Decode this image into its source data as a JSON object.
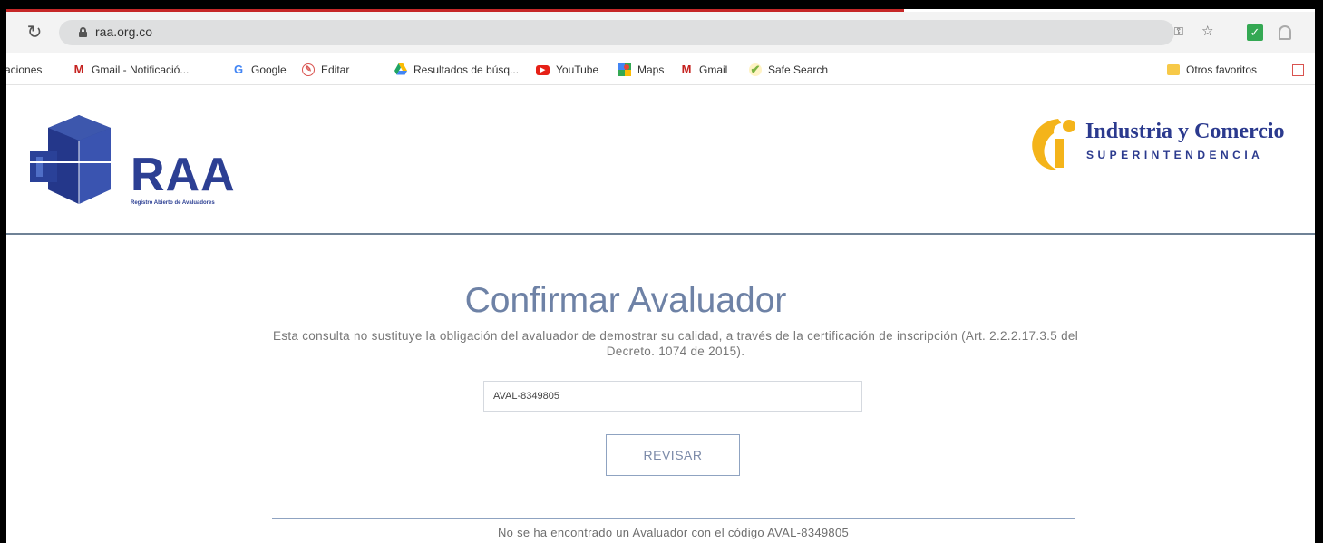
{
  "browser": {
    "url": "raa.org.co",
    "bookmarks": [
      {
        "label": "aciones",
        "icon": "none"
      },
      {
        "label": "Gmail - Notificació...",
        "icon": "gmail-icon"
      },
      {
        "label": "Google",
        "icon": "google-icon"
      },
      {
        "label": "Editar",
        "icon": "edit-icon"
      },
      {
        "label": "Resultados de búsq...",
        "icon": "drive-icon"
      },
      {
        "label": "YouTube",
        "icon": "youtube-icon"
      },
      {
        "label": "Maps",
        "icon": "maps-icon"
      },
      {
        "label": "Gmail",
        "icon": "gmail-icon"
      },
      {
        "label": "Safe Search",
        "icon": "safe-search-icon"
      },
      {
        "label": "Otros favoritos",
        "icon": "folder-icon"
      }
    ]
  },
  "header": {
    "logo_text": "RAA",
    "logo_subtitle": "Registro Abierto de Avaluadores",
    "sic_title": "Industria y Comercio",
    "sic_subtitle": "SUPERINTENDENCIA"
  },
  "main": {
    "title": "Confirmar Avaluador",
    "disclaimer": "Esta consulta no sustituye la obligación del avaluador de demostrar su calidad, a través de la certificación de inscripción (Art. 2.2.2.17.3.5 del Decreto. 1074 de 2015).",
    "code_value": "AVAL-8349805",
    "button_label": "REVISAR",
    "result": "No se ha encontrado un Avaluador con el código AVAL-8349805"
  },
  "colors": {
    "brand_blue": "#2c3f93",
    "title_blue": "#6e82a6",
    "sic_yellow": "#f4b41a"
  }
}
